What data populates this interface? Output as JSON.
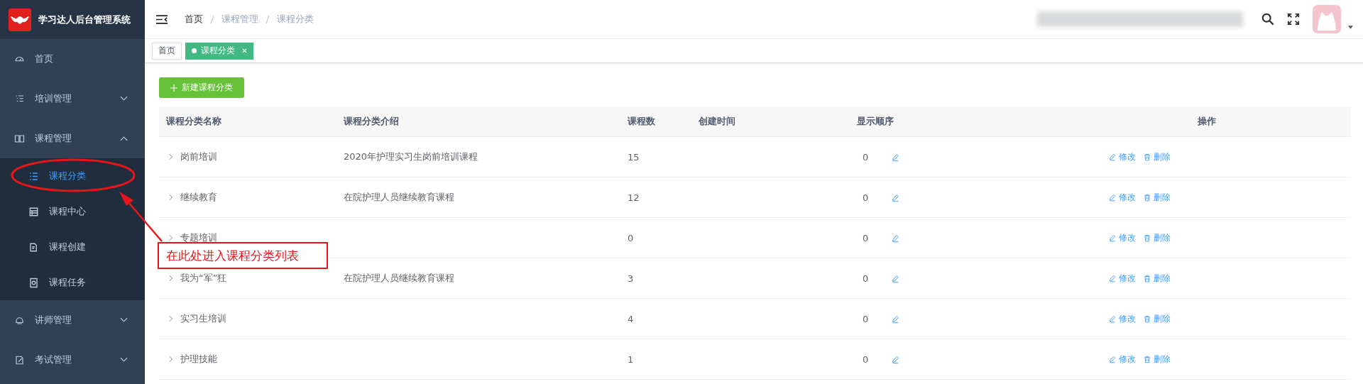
{
  "app": {
    "title": "学习达人后台管理系统"
  },
  "sidebar": {
    "items": [
      {
        "label": "首页",
        "selected": false
      },
      {
        "label": "培训管理",
        "expanded": false,
        "selected": false
      },
      {
        "label": "课程管理",
        "expanded": true,
        "selected": false,
        "children": [
          {
            "label": "课程分类",
            "selected": true
          },
          {
            "label": "课程中心",
            "selected": false
          },
          {
            "label": "课程创建",
            "selected": false
          },
          {
            "label": "课程任务",
            "selected": false
          }
        ]
      },
      {
        "label": "讲师管理",
        "expanded": false,
        "selected": false
      },
      {
        "label": "考试管理",
        "expanded": false,
        "selected": false
      }
    ]
  },
  "breadcrumb": [
    "首页",
    "课程管理",
    "课程分类"
  ],
  "tabs": [
    {
      "label": "首页",
      "selected": false
    },
    {
      "label": "课程分类",
      "selected": true
    }
  ],
  "add_button": {
    "label": "新建课程分类"
  },
  "table": {
    "columns": [
      "课程分类名称",
      "课程分类介绍",
      "课程数",
      "创建时间",
      "显示顺序",
      "操作"
    ],
    "rows": [
      {
        "name": "岗前培训",
        "intro": "2020年护理实习生岗前培训课程",
        "count": "15",
        "order": "0",
        "actions": [
          "修改",
          "删除"
        ]
      },
      {
        "name": "继续教育",
        "intro": "在院护理人员继续教育课程",
        "count": "12",
        "order": "0",
        "actions": [
          "修改",
          "删除"
        ]
      },
      {
        "name": "专题培训",
        "count": "0",
        "order": "0",
        "actions": [
          "修改",
          "删除"
        ]
      },
      {
        "name": "我为“军”狂",
        "intro": "在院护理人员继续教育课程",
        "count": "3",
        "order": "0",
        "actions": [
          "修改",
          "删除"
        ]
      },
      {
        "name": "实习生培训",
        "count": "4",
        "order": "0",
        "actions": [
          "修改",
          "删除"
        ]
      },
      {
        "name": "护理技能",
        "count": "1",
        "order": "0",
        "actions": [
          "修改",
          "删除"
        ]
      }
    ]
  },
  "annotation": {
    "text": "在此处进入课程分类列表"
  }
}
